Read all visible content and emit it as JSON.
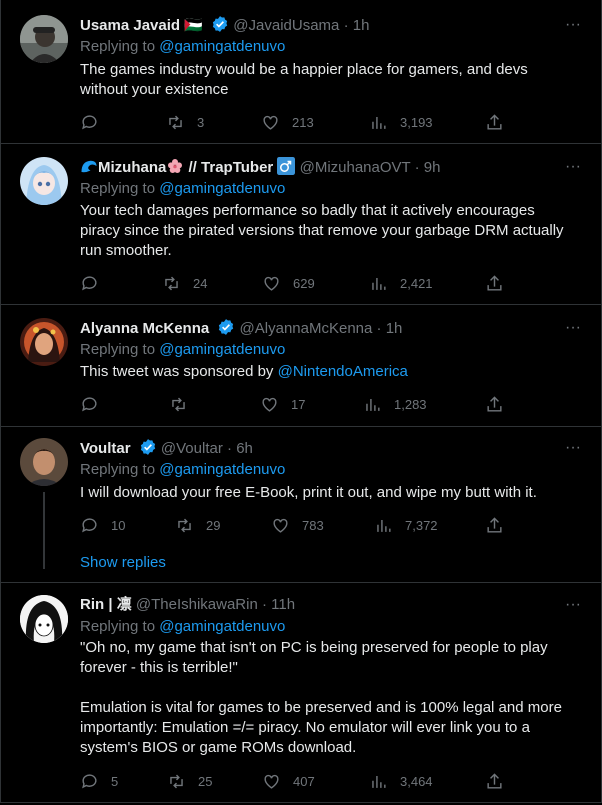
{
  "replies": [
    {
      "name": "Usama Javaid",
      "flag": "🇵🇸",
      "handle": "@JavaidUsama",
      "time": "1h",
      "replying_label": "Replying to",
      "replying_handle": "@gamingatdenuvo",
      "text": "The games industry would be a happier place for gamers, and devs\nwithout your existence",
      "reposts": "3",
      "likes": "213",
      "views": "3,193"
    },
    {
      "name": "Mizuhana",
      "name_suffix": "// TrapTuber",
      "handle": "@MizuhanaOVT",
      "time": "9h",
      "replying_label": "Replying to",
      "replying_handle": "@gamingatdenuvo",
      "text": "Your tech damages performance so badly that it actively encourages\npiracy since the pirated versions that remove your garbage DRM actually\nrun smoother.",
      "reposts": "24",
      "likes": "629",
      "views": "2,421"
    },
    {
      "name": "Alyanna McKenna",
      "handle": "@AlyannaMcKenna",
      "time": "1h",
      "replying_label": "Replying to",
      "replying_handle": "@gamingatdenuvo",
      "text_prefix": "This tweet was sponsored by ",
      "text_mention": "@NintendoAmerica",
      "likes": "17",
      "views": "1,283"
    },
    {
      "name": "Voultar",
      "handle": "@Voultar",
      "time": "6h",
      "replying_label": "Replying to",
      "replying_handle": "@gamingatdenuvo",
      "text": "I will download your free E-Book, print it out, and wipe my butt with it.",
      "replies": "10",
      "reposts": "29",
      "likes": "783",
      "views": "7,372",
      "show_replies": "Show replies"
    },
    {
      "name": "Rin | 凛",
      "handle": "@TheIshikawaRin",
      "time": "11h",
      "replying_label": "Replying to",
      "replying_handle": "@gamingatdenuvo",
      "text": "\"Oh no, my game that isn't on PC is being preserved for people to play\nforever - this is terrible!\"\n\nEmulation is vital for games to be preserved and is 100% legal and more\nimportantly: Emulation =/= piracy. No emulator will ever link you to a\nsystem's BIOS or game ROMs download.",
      "replies": "5",
      "reposts": "25",
      "likes": "407",
      "views": "3,464"
    }
  ],
  "separator": "·",
  "more_icon": "···",
  "colors": {
    "background": "#000000",
    "text": "#e7e9ea",
    "muted": "#71767b",
    "link": "#1d9bf0",
    "border": "#2f3336",
    "verified": "#1d9bf0"
  }
}
